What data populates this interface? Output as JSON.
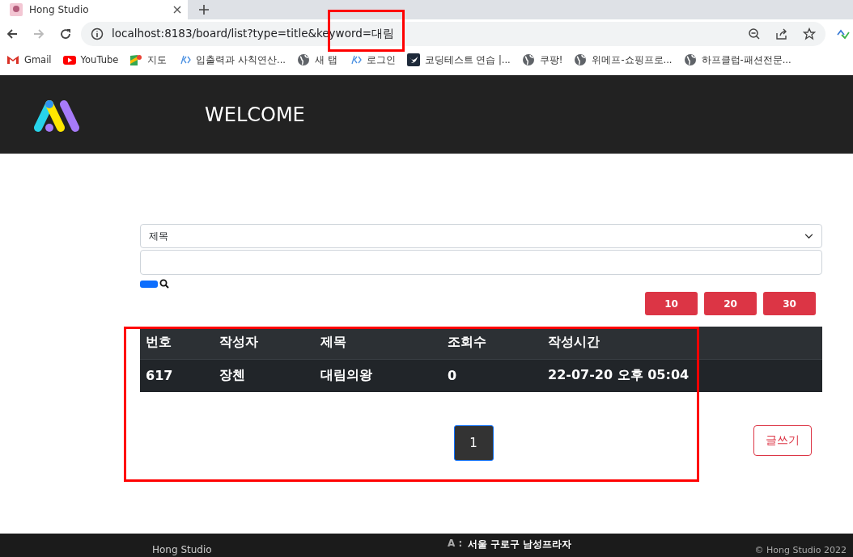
{
  "browser": {
    "tab_title": "Hong Studio",
    "url": "localhost:8183/board/list?type=title&keyword=대림",
    "bookmarks": [
      {
        "kind": "gmail",
        "label": "Gmail"
      },
      {
        "kind": "youtube",
        "label": "YouTube"
      },
      {
        "kind": "maps",
        "label": "지도"
      },
      {
        "kind": "code",
        "label": "입출력과 사칙연산..."
      },
      {
        "kind": "globe",
        "label": "새 탭"
      },
      {
        "kind": "code",
        "label": "로그인"
      },
      {
        "kind": "bird",
        "label": "코딩테스트 연습 |..."
      },
      {
        "kind": "globe",
        "label": "쿠팡!"
      },
      {
        "kind": "globe",
        "label": "위메프-쇼핑프로..."
      },
      {
        "kind": "globe",
        "label": "하프클럽-패션전문..."
      }
    ]
  },
  "header": {
    "title": "WELCOME"
  },
  "search": {
    "type_select": "제목"
  },
  "page_sizes": [
    "10",
    "20",
    "30"
  ],
  "table": {
    "columns": [
      "번호",
      "작성자",
      "제목",
      "조회수",
      "작성시간"
    ],
    "rows": [
      [
        "617",
        "장첸",
        "대림의왕",
        "0",
        "22-07-20 오후 05:04"
      ]
    ]
  },
  "pagination": [
    {
      "label": "1",
      "selected": true
    }
  ],
  "write_button": "글쓰기",
  "footer": {
    "brand": "Hong Studio",
    "address_label": "A :",
    "address": "서울 구로구 남성프라자",
    "copyright": "© Hong Studio 2022"
  }
}
